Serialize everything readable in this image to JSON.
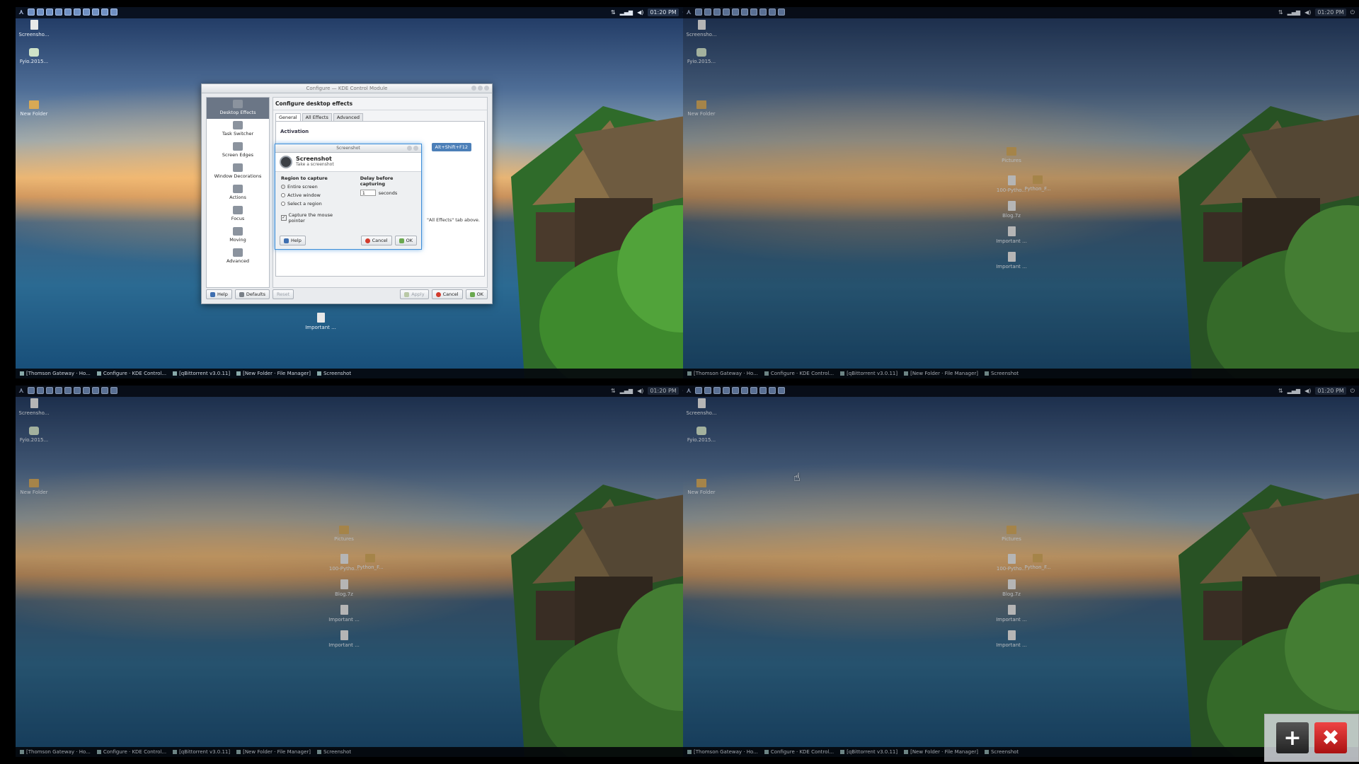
{
  "panel": {
    "clock": "01:20 PM"
  },
  "desktop_icons": [
    {
      "label": "Screensho...",
      "kind": "doc"
    },
    {
      "label": "Fyio.2015...",
      "kind": "app"
    },
    {
      "label": "New Folder",
      "kind": "folder"
    },
    {
      "label": "Important ...",
      "kind": "doc"
    }
  ],
  "workspace_icons_extra": [
    {
      "label": "Pictures",
      "kind": "folder"
    },
    {
      "label": "100-Pytho...",
      "kind": "doc"
    },
    {
      "label": "Python_F...",
      "kind": "folder"
    },
    {
      "label": "Blog.7z",
      "kind": "doc"
    },
    {
      "label": "Important ...",
      "kind": "doc"
    },
    {
      "label": "Important ...",
      "kind": "doc"
    }
  ],
  "taskbar": [
    "[Thomson Gateway · Ho...",
    "Configure · KDE Control...",
    "[qBittorrent v3.0.11]",
    "[New Folder · File Manager]",
    "Screenshot"
  ],
  "kcm_dialog": {
    "title": "Configure — KDE Control Module",
    "heading": "Configure desktop effects",
    "sidebar": [
      "Desktop Effects",
      "Task Switcher",
      "Screen Edges",
      "Window Decorations",
      "Actions",
      "Focus",
      "Moving",
      "Advanced"
    ],
    "tabs": [
      "General",
      "All Effects",
      "Advanced"
    ],
    "activation_label": "Activation",
    "shortcut": "Alt+Shift+F12",
    "hint": "\"All Effects\" tab above.",
    "buttons": {
      "help": "Help",
      "defaults": "Defaults",
      "reset": "Reset",
      "apply": "Apply",
      "cancel": "Cancel",
      "ok": "OK"
    }
  },
  "screenshot_dialog": {
    "title": "Screenshot",
    "app_name": "Screenshot",
    "subtitle": "Take a screenshot",
    "region_label": "Region to capture",
    "regions": [
      "Entire screen",
      "Active window",
      "Select a region"
    ],
    "selected_region": "Entire screen",
    "delay_label": "Delay before capturing",
    "delay_value": "1",
    "delay_unit": "seconds",
    "capture_pointer": "Capture the mouse pointer",
    "buttons": {
      "help": "Help",
      "cancel": "Cancel",
      "ok": "OK"
    }
  },
  "workspace_controls": {
    "add": "+",
    "remove": "✖"
  }
}
